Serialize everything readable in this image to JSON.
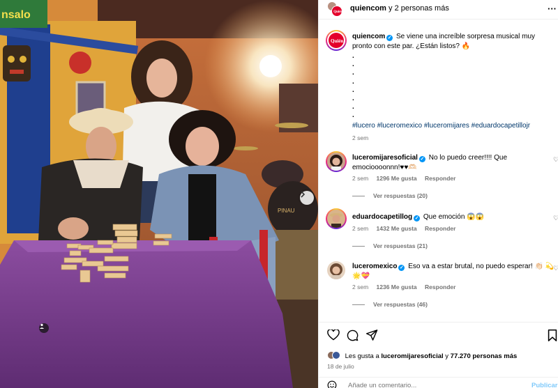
{
  "photo": {
    "sign_text": "nsalo",
    "wall_text": "PINAU"
  },
  "header": {
    "account": "quiencom",
    "coauthors": "y 2 personas más"
  },
  "caption": {
    "username": "quiencom",
    "text": "Se viene una increíble sorpresa musical muy pronto con este par. ¿Están listos? 🔥",
    "dots": [
      ".",
      ".",
      ".",
      ".",
      ".",
      ".",
      ".",
      "."
    ],
    "hashtags": "#lucero #luceromexico #luceromijares #eduardocapetillojr",
    "time": "2 sem"
  },
  "comments": [
    {
      "username": "luceromijaresoficial",
      "text": "No lo puedo creer!!!! Que emocioooonnn!♥♥🫶🏻",
      "time": "2 sem",
      "likes": "1296 Me gusta",
      "reply_label": "Responder",
      "view_replies": "Ver respuestas (20)"
    },
    {
      "username": "eduardocapetillog",
      "text": "Que emoción 😱😱",
      "time": "2 sem",
      "likes": "1432 Me gusta",
      "reply_label": "Responder",
      "view_replies": "Ver respuestas (21)"
    },
    {
      "username": "luceromexico",
      "text": "Eso va a estar brutal, no puedo esperar! 👏🏻 💫🌟💝",
      "time": "2 sem",
      "likes": "1236 Me gusta",
      "reply_label": "Responder",
      "view_replies": "Ver respuestas (46)"
    }
  ],
  "likes_summary": {
    "prefix": "Les gusta a",
    "first_user": "luceromijaresoficial",
    "middle": "y",
    "others": "77.270 personas más"
  },
  "date": "18 de julio",
  "comment_box": {
    "placeholder": "Añade un comentario...",
    "post_label": "Publicar"
  },
  "colors": {
    "accent": "#0095f6",
    "hashtag": "#00376b",
    "muted": "#737373",
    "brand_red": "#e4002b"
  },
  "icons": [
    "heart-icon",
    "comment-icon",
    "share-icon",
    "bookmark-icon",
    "more-icon",
    "verified-icon",
    "chevron-right-icon",
    "tag-icon"
  ]
}
